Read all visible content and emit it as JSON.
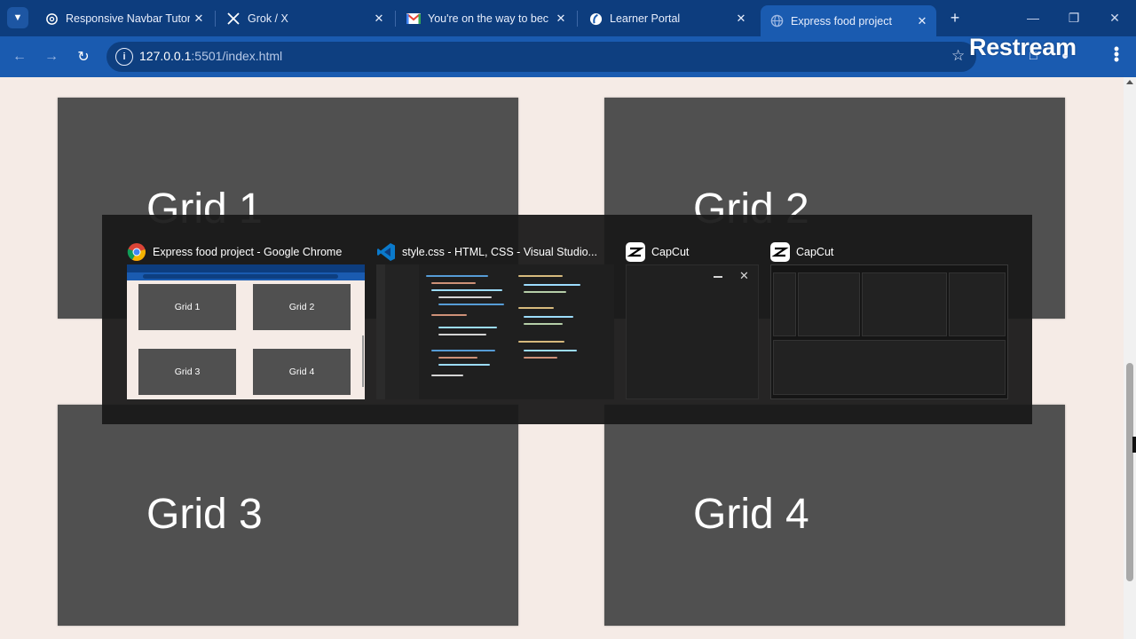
{
  "browser": {
    "tabs": [
      {
        "icon": "openai-icon",
        "label": "Responsive Navbar Tutor",
        "active": false
      },
      {
        "icon": "x-logo-icon",
        "label": "Grok / X",
        "active": false
      },
      {
        "icon": "gmail-icon",
        "label": "You're on the way to bec",
        "active": false
      },
      {
        "icon": "learner-portal-icon",
        "label": "Learner Portal",
        "active": false
      },
      {
        "icon": "globe-icon",
        "label": "Express food project",
        "active": true
      }
    ],
    "url_host": "127.0.0.1",
    "url_rest": ":5501/index.html",
    "overlay_brand": "Restream",
    "accent_color": "#1a5bb0",
    "tabstrip_color": "#0d3d7e"
  },
  "page": {
    "background": "#f5ebe6",
    "grids": [
      {
        "label": "Grid 1"
      },
      {
        "label": "Grid 2"
      },
      {
        "label": "Grid 3"
      },
      {
        "label": "Grid 4"
      }
    ],
    "grid_color": "#505050"
  },
  "task_switcher": {
    "items": [
      {
        "app": "chrome-icon",
        "title": "Express food project - Google Chrome",
        "thumb_labels": [
          "Grid 1",
          "Grid 2",
          "Grid 3",
          "Grid 4"
        ]
      },
      {
        "app": "vscode-icon",
        "title": "style.css - HTML, CSS - Visual Studio..."
      },
      {
        "app": "capcut-icon",
        "title": "CapCut"
      },
      {
        "app": "capcut-icon",
        "title": "CapCut"
      }
    ]
  }
}
